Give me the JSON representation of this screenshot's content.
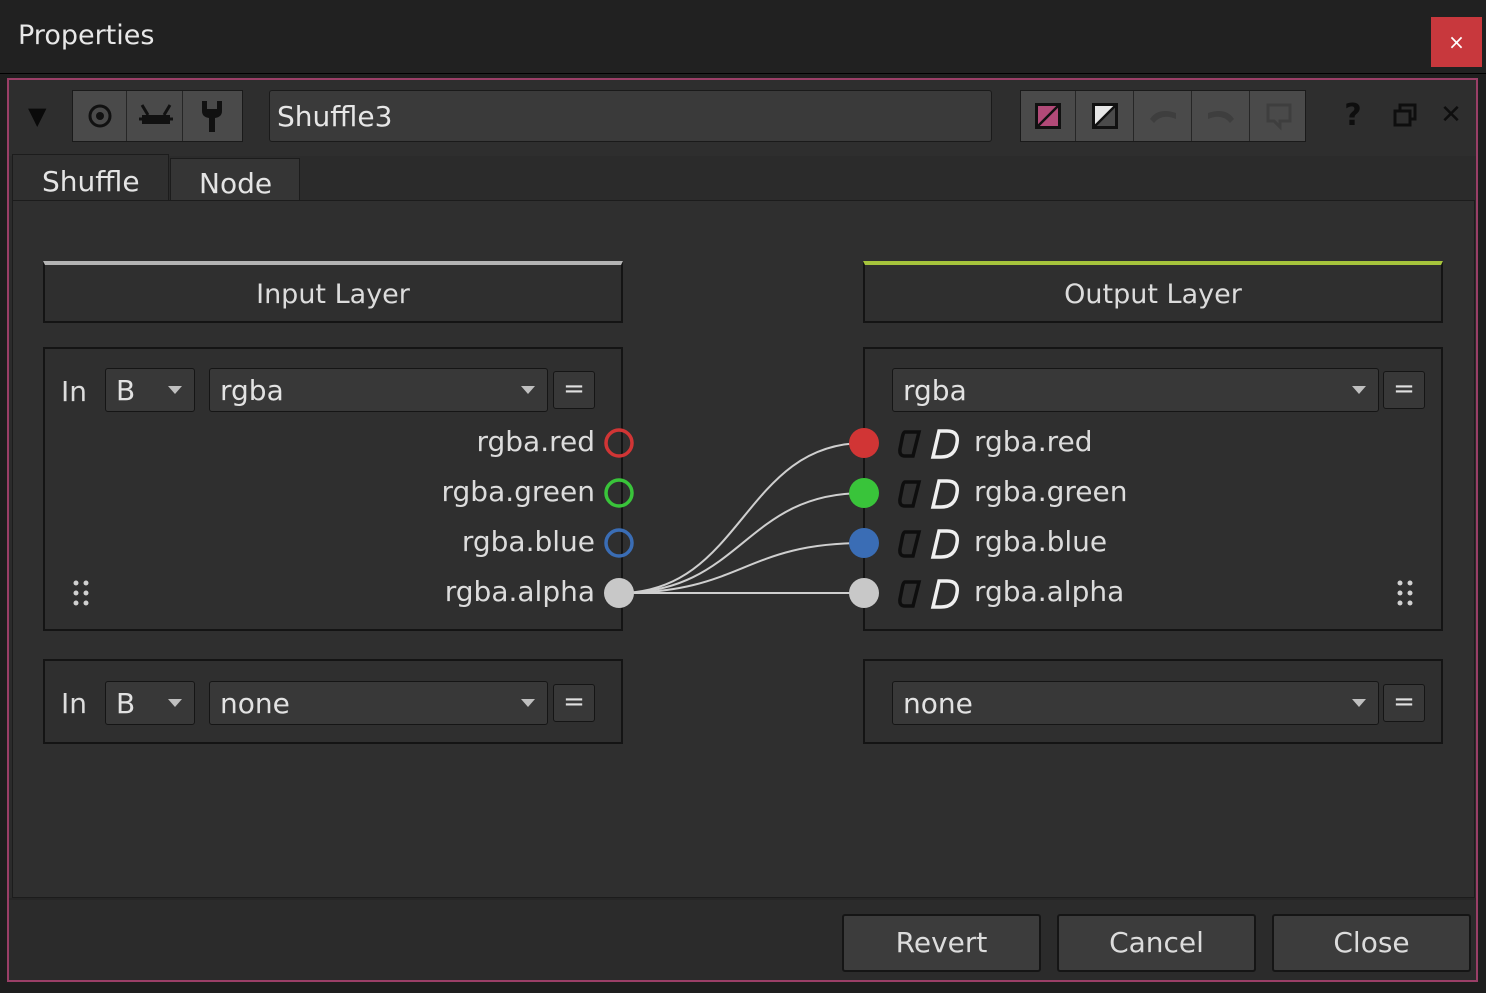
{
  "window": {
    "title": "Properties",
    "close_glyph": "×"
  },
  "toolbar": {
    "node_name": "Shuffle3",
    "help_glyph": "?",
    "close_glyph": "✕"
  },
  "tabs": [
    {
      "label": "Shuffle"
    },
    {
      "label": "Node"
    }
  ],
  "input_layer": {
    "header": "Input Layer",
    "row1": {
      "in_label": "In",
      "source": "B",
      "layer": "rgba",
      "eq": "="
    },
    "row2": {
      "in_label": "In",
      "source": "B",
      "layer": "none",
      "eq": "="
    },
    "channels": [
      "rgba.red",
      "rgba.green",
      "rgba.blue",
      "rgba.alpha"
    ]
  },
  "output_layer": {
    "header": "Output Layer",
    "row1": {
      "layer": "rgba",
      "eq": "="
    },
    "row2": {
      "layer": "none",
      "eq": "="
    },
    "channels": [
      "rgba.red",
      "rgba.green",
      "rgba.blue",
      "rgba.alpha"
    ]
  },
  "channel_colors": {
    "red": "#d13535",
    "green": "#39c43a",
    "blue": "#3a6db5",
    "alpha": "#c8c8c8"
  },
  "colors": {
    "frame_border": "#9a3f67",
    "output_accent": "#a6c43c",
    "input_accent": "#b4b4b4",
    "close_button": "#c8383d"
  },
  "footer": {
    "revert": "Revert",
    "cancel": "Cancel",
    "close": "Close"
  }
}
